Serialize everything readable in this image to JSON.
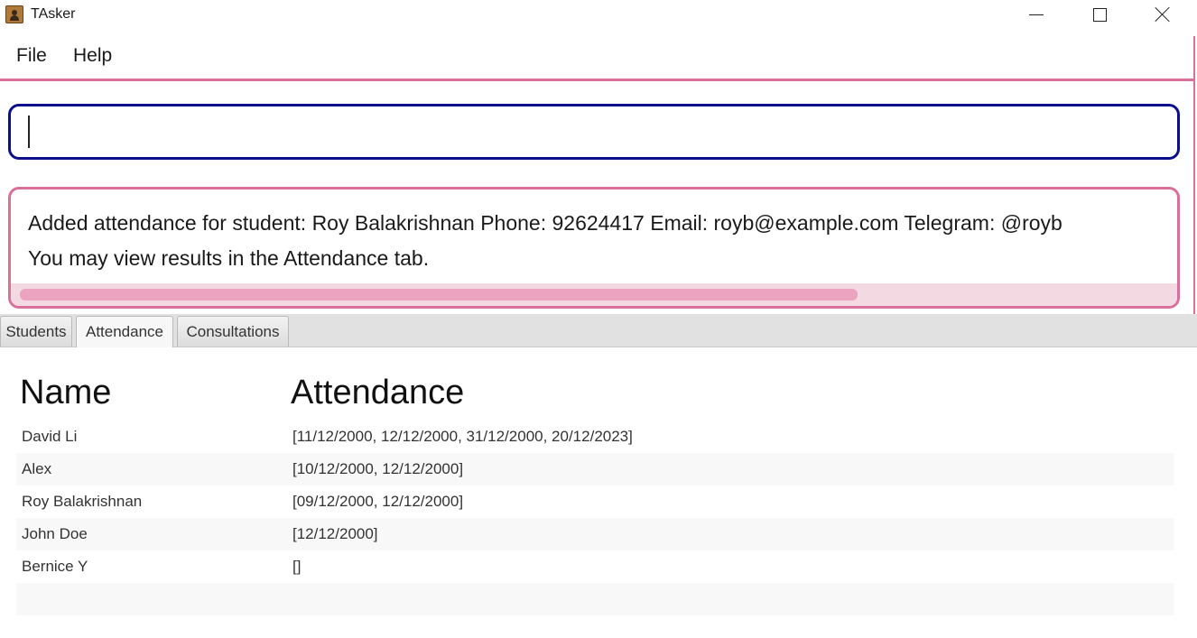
{
  "window": {
    "title": "TAsker"
  },
  "menu": {
    "file": "File",
    "help": "Help"
  },
  "command": {
    "value": ""
  },
  "result": {
    "line1": "Added attendance for student: Roy Balakrishnan Phone: 92624417 Email: royb@example.com Telegram: @royb",
    "line2": "You may view results in the Attendance tab."
  },
  "tabs": [
    {
      "label": "Students",
      "active": false
    },
    {
      "label": "Attendance",
      "active": true
    },
    {
      "label": "Consultations",
      "active": false
    }
  ],
  "table": {
    "headers": {
      "name": "Name",
      "attendance": "Attendance"
    },
    "rows": [
      {
        "name": "David Li",
        "attendance": "[11/12/2000, 12/12/2000, 31/12/2000, 20/12/2023]"
      },
      {
        "name": "Alex",
        "attendance": "[10/12/2000, 12/12/2000]"
      },
      {
        "name": "Roy Balakrishnan",
        "attendance": "[09/12/2000, 12/12/2000]"
      },
      {
        "name": "John Doe",
        "attendance": "[12/12/2000]"
      },
      {
        "name": "Bernice Y",
        "attendance": "[]"
      },
      {
        "name": "",
        "attendance": ""
      }
    ]
  },
  "colors": {
    "accent_pink": "#d9709a",
    "command_border": "#0b0f8a",
    "scrollbar_thumb": "#eba3bf"
  }
}
